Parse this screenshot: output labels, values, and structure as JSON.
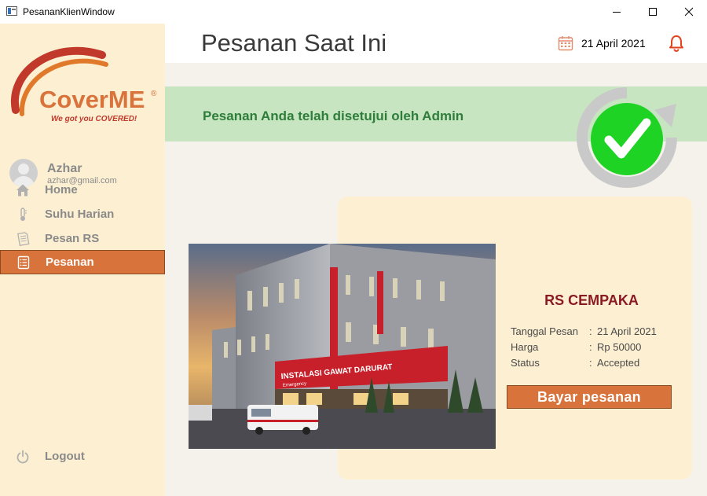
{
  "window": {
    "title": "PesananKlienWindow"
  },
  "brand": {
    "name": "CoverME",
    "registered": "®",
    "tagline": "We got you COVERED!"
  },
  "user": {
    "name": "Azhar",
    "email": "azhar@gmail.com"
  },
  "sidebar": {
    "items": [
      {
        "label": "Home",
        "icon": "home-icon"
      },
      {
        "label": "Suhu Harian",
        "icon": "thermometer-icon"
      },
      {
        "label": "Pesan RS",
        "icon": "document-icon"
      },
      {
        "label": "Pesanan",
        "icon": "list-icon",
        "active": true
      }
    ],
    "logout": {
      "label": "Logout",
      "icon": "power-icon"
    }
  },
  "header": {
    "title": "Pesanan Saat Ini",
    "date": "21 April 2021"
  },
  "banner": {
    "message": "Pesanan Anda telah disetujui oleh Admin"
  },
  "order": {
    "hospital": "RS CEMPAKA",
    "sign_text": "INSTALASI GAWAT DARURAT",
    "sign_sub": "Emergency",
    "fields": [
      {
        "label": "Tanggal Pesan",
        "sep": ":",
        "value": "21 April 2021"
      },
      {
        "label": "Harga",
        "sep": ":",
        "value": "Rp 50000"
      },
      {
        "label": "Status",
        "sep": ":",
        "value": "Accepted"
      }
    ],
    "pay_button": "Bayar pesanan"
  },
  "colors": {
    "accent": "#d9733c",
    "sidebar_bg": "#fdefd2",
    "success_bg": "#c6e5c0",
    "success_text": "#2e7d3a",
    "hospital_name": "#8b1a24"
  }
}
